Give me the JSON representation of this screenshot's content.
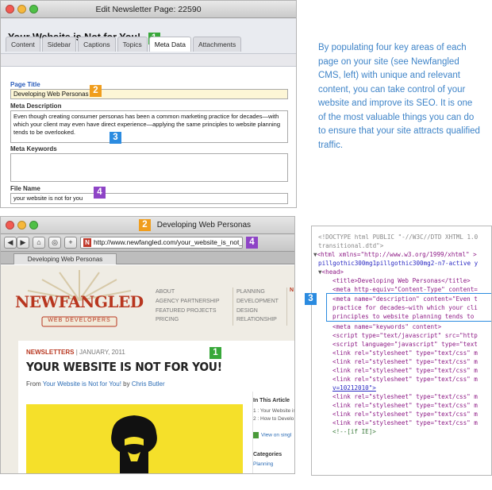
{
  "badges": {
    "b1": "1",
    "b2": "2",
    "b3": "3",
    "b4": "4"
  },
  "cms": {
    "window_title": "Edit Newsletter Page: 22590",
    "page_heading": "Your Website is Not for You!",
    "tabs": [
      "Content",
      "Sidebar",
      "Captions",
      "Topics",
      "Meta Data",
      "Attachments"
    ],
    "page_title_label": "Page Title",
    "page_title_value": "Developing Web Personas",
    "meta_description_label": "Meta Description",
    "meta_description_value": "Even though creating consumer personas has been a common marketing practice for decades—with which your client may even have direct experience—applying the same principles to website planning tends to be overlooked.",
    "meta_keywords_label": "Meta Keywords",
    "meta_keywords_value": "",
    "file_name_label": "File Name",
    "file_name_value": "your website is not for you"
  },
  "blurb": "By populating four key areas of each page on your site (see Newfangled CMS, left) with unique and relevant content, you can take control of your website and improve its SEO. It is one of the most valuable things you can do to ensure that your site attracts qualified traffic.",
  "browser": {
    "window_title": "Developing Web Personas",
    "url": "http://www.newfangled.com/your_website_is_not_for_you",
    "tab_title": "Developing Web Personas",
    "url_icon": "N",
    "nav_icons": [
      "◀",
      "▶",
      "⌂",
      "◎",
      "+"
    ]
  },
  "site": {
    "logo_text": "NEWFANGLED",
    "logo_subtext": "WEB DEVELOPERS",
    "nav_col1": [
      "ABOUT",
      "AGENCY PARTNERSHIP",
      "FEATURED PROJECTS",
      "PRICING"
    ],
    "nav_col2": [
      "PLANNING",
      "DEVELOPMENT",
      "DESIGN",
      "RELATIONSHIP"
    ],
    "nav_col3_partial": "N",
    "section": "NEWSLETTERS",
    "date": "| JANUARY, 2011",
    "headline": "YOUR WEBSITE IS NOT FOR YOU!",
    "byline_from": "From",
    "byline_link": "Your Website is Not for You!",
    "byline_by": "by",
    "byline_author": "Chris Butler",
    "sidebar_heading": "In This Article",
    "sidebar_items": [
      "1 : Your Website is",
      "2 : How to Develo"
    ],
    "sidebar_view": "View on singl",
    "categories_heading": "Categories",
    "categories_item": "Planning"
  },
  "code": {
    "l1": "<!DOCTYPE html PUBLIC \"-//W3C//DTD XHTML 1.0",
    "l2": "transitional.dtd\">",
    "l3": "<html xmlns=\"http://www.w3.org/1999/xhtml\" >",
    "l4": "pillgothic300mg1pillgothic300mg2-n7-active y",
    "l5": "<head>",
    "l6": "<title>Developing Web Personas</title>",
    "l7": "<meta http-equiv=\"Content-Type\" content=",
    "l8": "<meta name=\"description\" content=\"Even t",
    "l9": "practice for decades—with which your cli",
    "l10": "principles to website planning tends to",
    "l11": "<meta name=\"keywords\" content>",
    "l12": "<script type=\"text/javascript\" src=\"http",
    "l13": "<script language=\"javascript\" type=\"text",
    "l14": "<link rel=\"stylesheet\" type=\"text/css\" m",
    "l15": "<link rel=\"stylesheet\" type=\"text/css\" m",
    "l16": "<link rel=\"stylesheet\" type=\"text/css\" m",
    "l17": "<link rel=\"stylesheet\" type=\"text/css\" m",
    "l18": "v=10212010\">",
    "l19": "<link rel=\"stylesheet\" type=\"text/css\" m",
    "l20": "<link rel=\"stylesheet\" type=\"text/css\" m",
    "l21": "<link rel=\"stylesheet\" type=\"text/css\" m",
    "l22": "<link rel=\"stylesheet\" type=\"text/css\" m",
    "l23": "<!--[if IE]>"
  },
  "colors": {
    "accent_blue": "#3f84c8",
    "badge_green": "#38a83a",
    "badge_orange": "#f09d1c",
    "badge_blue": "#2b8be0",
    "badge_purple": "#8e44c6",
    "logo_red": "#b8361f"
  }
}
